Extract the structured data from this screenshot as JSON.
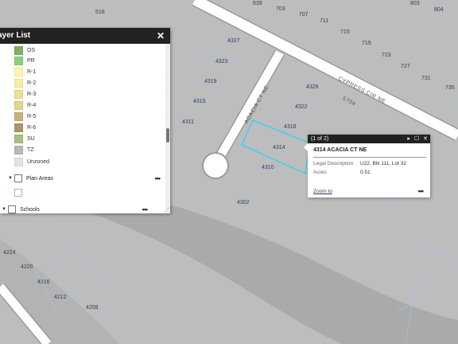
{
  "map": {
    "parcel_labels": [
      "518",
      "639",
      "703",
      "707",
      "803",
      "804",
      "711",
      "715",
      "719",
      "723",
      "727",
      "731",
      "735",
      "4327",
      "4323",
      "4326",
      "4319",
      "4322",
      "4315",
      "4318",
      "4311",
      "4314",
      "4310",
      "4302",
      "4224",
      "4220",
      "4216",
      "4212",
      "4208"
    ],
    "street_labels": [
      "ACACIA CT NE",
      "CYPRESS CIR NE",
      "5704"
    ],
    "colors": {
      "background": "#bdbdbd",
      "road": "#ffffff",
      "road_edge": "#9a9a9a",
      "parcel_line": "#a7c0e6",
      "selection": "#3fd0e6",
      "river": "#a8a8a8"
    }
  },
  "layer_list": {
    "title": "ayer List",
    "close_icon": "close-icon",
    "zoning_legend": [
      {
        "label": "OS",
        "color": "#7fae6a"
      },
      {
        "label": "PR",
        "color": "#8ed07c"
      },
      {
        "label": "R-1",
        "color": "#f9f8a8"
      },
      {
        "label": "R-2",
        "color": "#f7efa0"
      },
      {
        "label": "R-3",
        "color": "#efe095"
      },
      {
        "label": "R-4",
        "color": "#e8d28e"
      },
      {
        "label": "R-5",
        "color": "#c8b07a"
      },
      {
        "label": "R-6",
        "color": "#aa9768"
      },
      {
        "label": "SU",
        "color": "#a3c27f"
      },
      {
        "label": "TZ",
        "color": "#b9b9b9"
      },
      {
        "label": "Unzoned",
        "color": "#e4e4e4"
      }
    ],
    "plan_areas": {
      "label": "Plan Areas",
      "more": "•••",
      "swatch_color": "#e8a0a0"
    },
    "schools": {
      "label": "Schools",
      "more": "•••"
    }
  },
  "popup": {
    "pager": "(1 of 2)",
    "title": "4314 ACACIA CT NE",
    "fields": [
      {
        "name": "Legal Description",
        "value": "U22, Blk 111, Lot 32"
      },
      {
        "name": "Acres",
        "value": "0.51"
      }
    ],
    "zoom_link": "Zoom to",
    "more": "•••",
    "buttons": {
      "next": "▸",
      "maximize": "☐",
      "close": "✕"
    }
  }
}
